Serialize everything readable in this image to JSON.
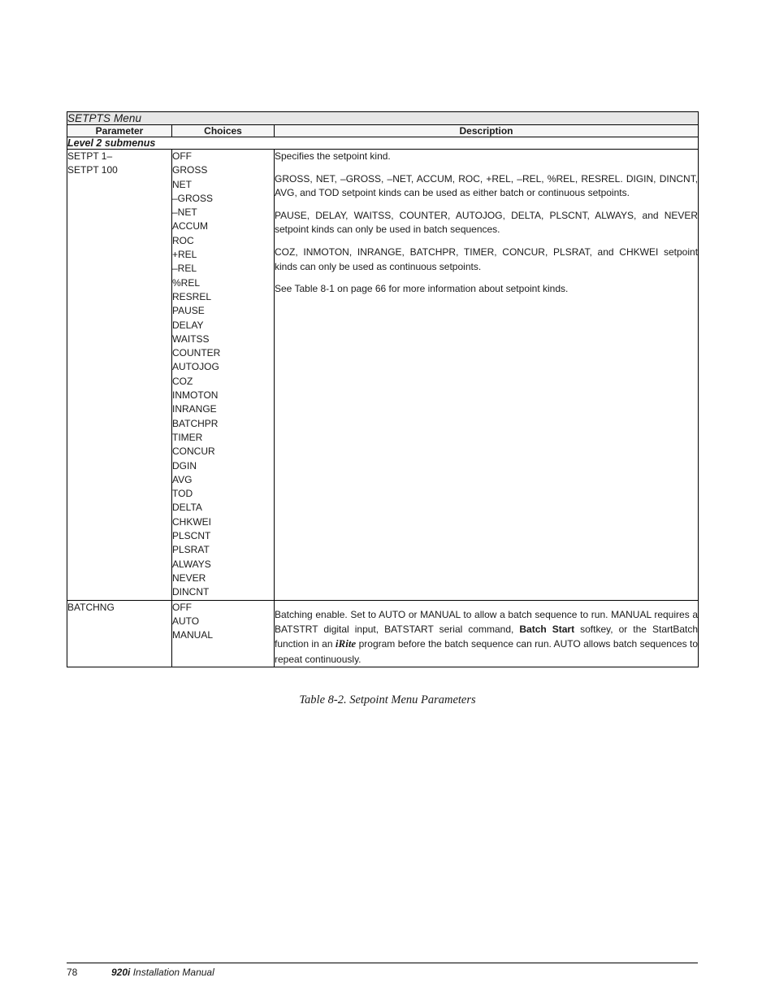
{
  "table": {
    "title": "SETPTS Menu",
    "columns": {
      "parameter": "Parameter",
      "choices": "Choices",
      "description": "Description"
    },
    "section_row": "Level 2 submenus",
    "rows": [
      {
        "parameter": "SETPT 1–\nSETPT 100",
        "choices": [
          "OFF",
          "GROSS",
          "NET",
          "–GROSS",
          "–NET",
          "ACCUM",
          "ROC",
          "+REL",
          "–REL",
          "%REL",
          "RESREL",
          "PAUSE",
          "DELAY",
          "WAITSS",
          "COUNTER",
          "AUTOJOG",
          "COZ",
          "INMOTON",
          "INRANGE",
          "BATCHPR",
          "TIMER",
          "CONCUR",
          "DGIN",
          "AVG",
          "TOD",
          "DELTA",
          "CHKWEI",
          "PLSCNT",
          "PLSRAT",
          "ALWAYS",
          "NEVER",
          "DINCNT"
        ],
        "description_paragraphs": [
          "Specifies the setpoint kind.",
          "GROSS, NET, –GROSS, –NET, ACCUM, ROC, +REL, –REL, %REL, RESREL. DIGIN, DINCNT, AVG, and TOD setpoint kinds can be used as either batch or continuous setpoints.",
          "PAUSE, DELAY, WAITSS, COUNTER, AUTOJOG, DELTA, PLSCNT, ALWAYS, and NEVER setpoint kinds can only be used in batch sequences.",
          "COZ, INMOTON, INRANGE, BATCHPR, TIMER, CONCUR, PLSRAT, and CHKWEI setpoint kinds can only be used as continuous setpoints.",
          "See Table 8-1 on page 66 for more information about setpoint kinds."
        ]
      },
      {
        "parameter": "BATCHNG",
        "choices": [
          "OFF",
          "AUTO",
          "MANUAL"
        ],
        "description_rich": {
          "part1": "Batching enable. Set to AUTO or MANUAL to allow a batch sequence to run. MANUAL requires a BATSTRT digital input, BATSTART serial command, ",
          "bold1": "Batch Start",
          "part2": " softkey, or the StartBatch function in an ",
          "italic1": "iRite",
          "part3": " program before the batch sequence can run. AUTO allows batch sequences to repeat continuously."
        }
      }
    ]
  },
  "caption": "Table 8-2. Setpoint Menu Parameters",
  "footer": {
    "page_number": "78",
    "manual_model": "920i",
    "manual_title": "Installation Manual"
  }
}
